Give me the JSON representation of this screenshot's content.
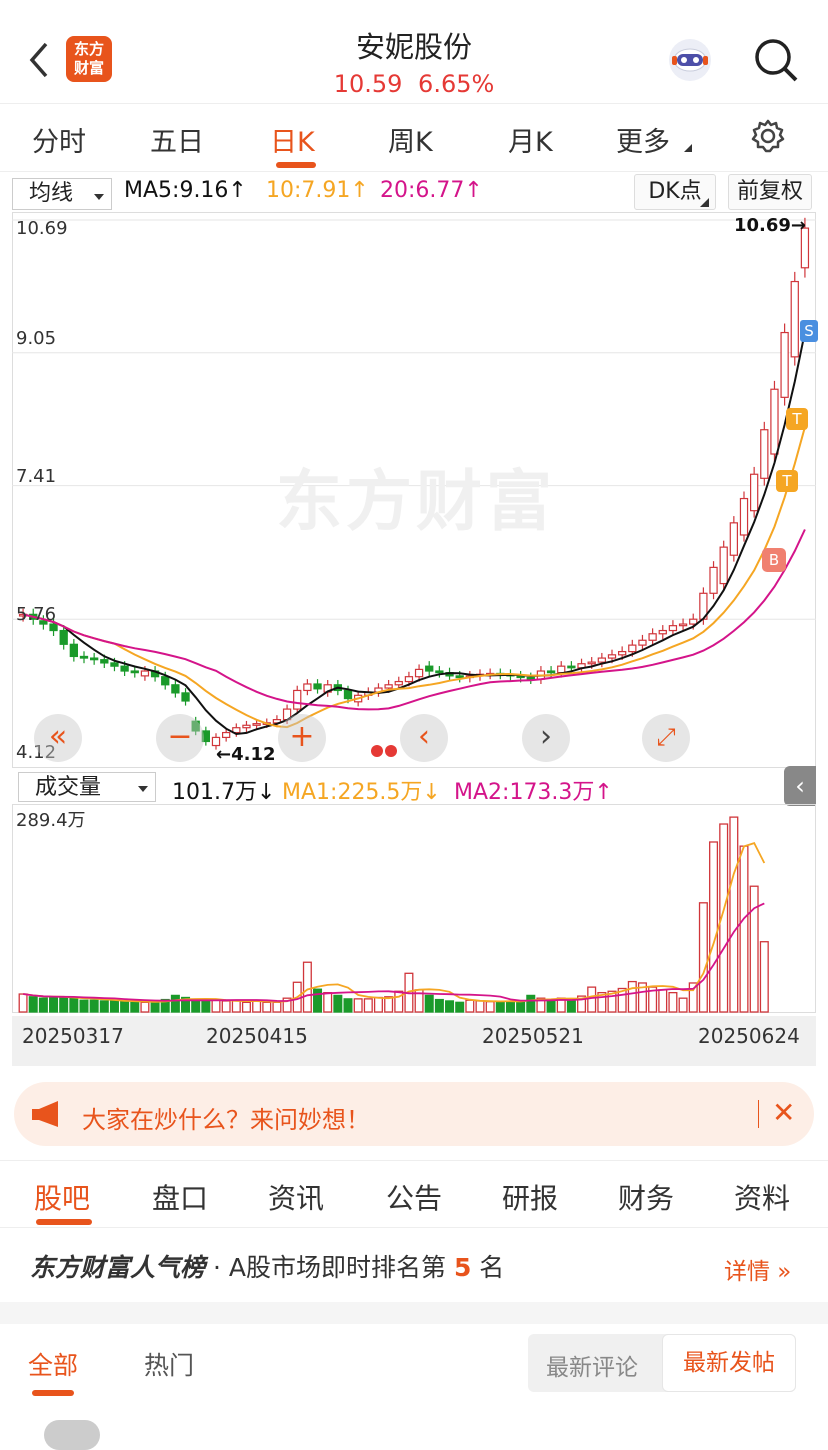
{
  "header": {
    "title": "安妮股份",
    "price": "10.59",
    "change": "6.65%",
    "logo_line1": "东方",
    "logo_line2": "财富"
  },
  "tabs": [
    {
      "label": "分时"
    },
    {
      "label": "五日"
    },
    {
      "label": "日K"
    },
    {
      "label": "周K"
    },
    {
      "label": "月K"
    },
    {
      "label": "更多"
    }
  ],
  "ma_bar": {
    "select": "均线",
    "ma5": "MA5:9.16↑",
    "ma10": "10:7.91↑",
    "ma20": "20:6.77↑",
    "dk": "DK点",
    "fq": "前复权"
  },
  "price_axis": {
    "p1": "10.69",
    "p2": "9.05",
    "p3": "7.41",
    "p4": "5.76",
    "p5": "4.12",
    "high_mark": "10.69→",
    "low_mark": "←4.12"
  },
  "watermark": "东方财富",
  "markers": {
    "s": "S",
    "t": "T",
    "b": "B"
  },
  "vol_bar": {
    "select": "成交量",
    "vol": "101.7万↓",
    "ma1": "MA1:225.5万↓",
    "ma2": "MA2:173.3万↑",
    "max": "289.4万"
  },
  "dates": [
    "20250317",
    "20250415",
    "20250521",
    "20250624"
  ],
  "banner": {
    "text": "大家在炒什么？来问妙想！"
  },
  "nav2": [
    {
      "label": "股吧"
    },
    {
      "label": "盘口"
    },
    {
      "label": "资讯"
    },
    {
      "label": "公告"
    },
    {
      "label": "研报"
    },
    {
      "label": "财务"
    },
    {
      "label": "资料"
    }
  ],
  "rank": {
    "brand": "东方财富人气榜",
    "text": "A股市场即时排名第",
    "num": "5",
    "suffix": "名",
    "detail": "详情"
  },
  "sub": {
    "all": "全部",
    "hot": "热门",
    "latest_comment": "最新评论",
    "latest_post": "最新发帖"
  },
  "colors": {
    "accent": "#e8541c",
    "up": "#d0353a",
    "down": "#1a9a2a",
    "ma5": "#111111",
    "ma10": "#f5a623",
    "ma20": "#d4148a"
  },
  "chart_data": {
    "type": "candlestick",
    "ylim": [
      4.12,
      10.69
    ],
    "close": [
      5.82,
      5.76,
      5.7,
      5.62,
      5.45,
      5.3,
      5.28,
      5.26,
      5.22,
      5.18,
      5.12,
      5.1,
      5.12,
      5.05,
      4.95,
      4.85,
      4.75,
      4.38,
      4.25,
      4.3,
      4.36,
      4.42,
      4.45,
      4.47,
      4.48,
      4.52,
      4.65,
      4.88,
      4.96,
      4.9,
      4.95,
      4.88,
      4.78,
      4.82,
      4.86,
      4.91,
      4.95,
      4.99,
      5.05,
      5.14,
      5.12,
      5.1,
      5.06,
      5.04,
      5.06,
      5.08,
      5.09,
      5.08,
      5.06,
      5.04,
      5.02,
      5.12,
      5.1,
      5.18,
      5.16,
      5.21,
      5.23,
      5.28,
      5.32,
      5.36,
      5.44,
      5.5,
      5.58,
      5.62,
      5.68,
      5.7,
      5.76,
      6.08,
      6.4,
      6.65,
      6.95,
      7.25,
      7.55,
      8.1,
      8.6,
      9.3,
      9.93,
      10.59
    ],
    "open": [
      5.8,
      5.82,
      5.74,
      5.7,
      5.62,
      5.45,
      5.3,
      5.28,
      5.26,
      5.22,
      5.18,
      5.12,
      5.06,
      5.12,
      5.05,
      4.95,
      4.85,
      4.5,
      4.38,
      4.2,
      4.3,
      4.36,
      4.42,
      4.45,
      4.47,
      4.48,
      4.52,
      4.65,
      4.88,
      4.96,
      4.86,
      4.95,
      4.88,
      4.74,
      4.82,
      4.86,
      4.91,
      4.95,
      4.99,
      5.05,
      5.18,
      5.12,
      5.1,
      5.06,
      5.04,
      5.06,
      5.08,
      5.09,
      5.08,
      5.06,
      5.04,
      5.02,
      5.12,
      5.1,
      5.18,
      5.16,
      5.21,
      5.23,
      5.28,
      5.32,
      5.36,
      5.44,
      5.5,
      5.58,
      5.62,
      5.68,
      5.7,
      5.76,
      6.08,
      6.2,
      6.55,
      6.8,
      7.1,
      7.5,
      7.8,
      8.5,
      9.0,
      10.1
    ],
    "volume_wan": [
      26,
      22,
      20,
      21,
      21,
      21,
      17,
      17,
      16,
      16,
      15,
      14,
      14,
      15,
      18,
      24,
      21,
      16,
      16,
      17,
      16,
      16,
      14,
      16,
      14,
      14,
      20,
      43,
      72,
      33,
      28,
      24,
      19,
      19,
      19,
      21,
      22,
      30,
      56,
      32,
      24,
      18,
      16,
      14,
      17,
      16,
      15,
      15,
      15,
      15,
      24,
      20,
      18,
      20,
      16,
      23,
      36,
      28,
      30,
      34,
      44,
      42,
      36,
      32,
      28,
      20,
      42,
      158,
      246,
      272,
      282,
      240,
      182,
      101.7
    ],
    "ma5": "9.16",
    "ma10": "7.91",
    "ma20": "6.77"
  }
}
